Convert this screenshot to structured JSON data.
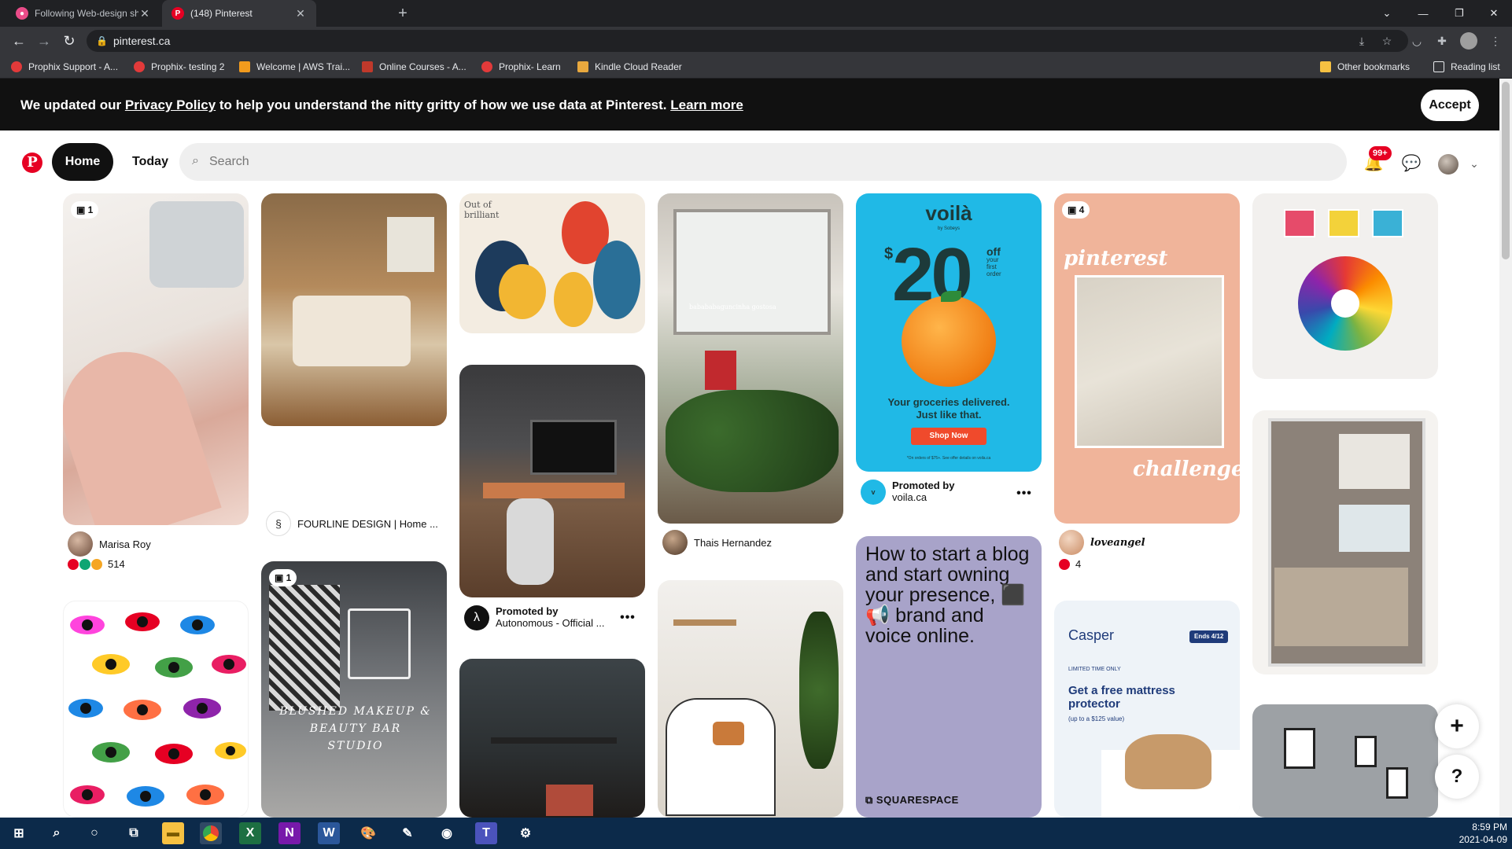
{
  "browser": {
    "tabs": [
      {
        "title": "Following Web-design shots on D",
        "active": false
      },
      {
        "title": "(148) Pinterest",
        "active": true
      }
    ],
    "url": "pinterest.ca",
    "bookmarks": [
      {
        "label": "Prophix Support - A...",
        "color": "#e23a3a"
      },
      {
        "label": "Prophix- testing 2",
        "color": "#e23a3a"
      },
      {
        "label": "Welcome | AWS Trai...",
        "color": "#f29b1d"
      },
      {
        "label": "Online Courses - A...",
        "color": "#c0392b"
      },
      {
        "label": "Prophix- Learn",
        "color": "#e23a3a"
      },
      {
        "label": "Kindle Cloud Reader",
        "color": "#e8a83e"
      }
    ],
    "other_bookmarks": "Other bookmarks",
    "reading_list": "Reading list"
  },
  "banner": {
    "text_1": "We updated our ",
    "privacy_link": "Privacy Policy",
    "text_2": " to help you understand the nitty gritty of how we use data at Pinterest. ",
    "learn_more": "Learn more",
    "accept": "Accept"
  },
  "header": {
    "logo": "P",
    "home": "Home",
    "today": "Today",
    "search_placeholder": "Search",
    "notifications_badge": "99+"
  },
  "pins": {
    "p1": {
      "count": "1",
      "author": "Marisa Roy",
      "reactions": "514"
    },
    "p2": {
      "title": "FOURLINE DESIGN | Home ..."
    },
    "p3": {
      "count": "1",
      "overlay_1": "BLUSHED MAKEUP &",
      "overlay_2": "BEAUTY BAR",
      "overlay_3": "STUDIO"
    },
    "p4": {
      "overlay": "Out of brilliant"
    },
    "p5": {
      "promoted_by": "Promoted by",
      "advertiser": "Autonomous - Official ..."
    },
    "p6": {
      "author": "Thais Hernandez",
      "overlay": "babababaguncinha gostosa"
    },
    "p7": {
      "brand": "voilà",
      "brand_sub": "by Sobeys",
      "amount": "20",
      "currency": "$",
      "off_1": "off",
      "off_2": "your",
      "off_3": "first",
      "off_4": "order",
      "tagline_1": "Your groceries delivered.",
      "tagline_2": "Just like that.",
      "cta": "Shop Now",
      "fine": "*On orders of $75+. See offer details on voila.ca",
      "promoted_by": "Promoted by",
      "advertiser": "voila.ca"
    },
    "p8": {
      "headline": "How to start a blog and start owning your presence, ⬛ 📢 brand and voice online.",
      "brand": "SQUARESPACE"
    },
    "p9": {
      "count": "4",
      "title_1": "pinterest",
      "title_2": "challenge",
      "author": "loveangel",
      "reactions": "4"
    },
    "p10": {
      "brand": "Casper",
      "ends": "Ends 4/12",
      "limited": "LIMITED TIME ONLY",
      "headline": "Get a free mattress protector",
      "sub": "(up to a $125 value)"
    }
  },
  "fab": {
    "add": "+",
    "help": "?"
  },
  "taskbar": {
    "time": "8:59 PM",
    "date": "2021-04-09"
  },
  "icons": {
    "back": "arrow-left-icon",
    "forward": "arrow-right-icon",
    "reload": "reload-icon",
    "search": "search-icon",
    "bell": "bell-icon",
    "chat": "chat-icon"
  }
}
